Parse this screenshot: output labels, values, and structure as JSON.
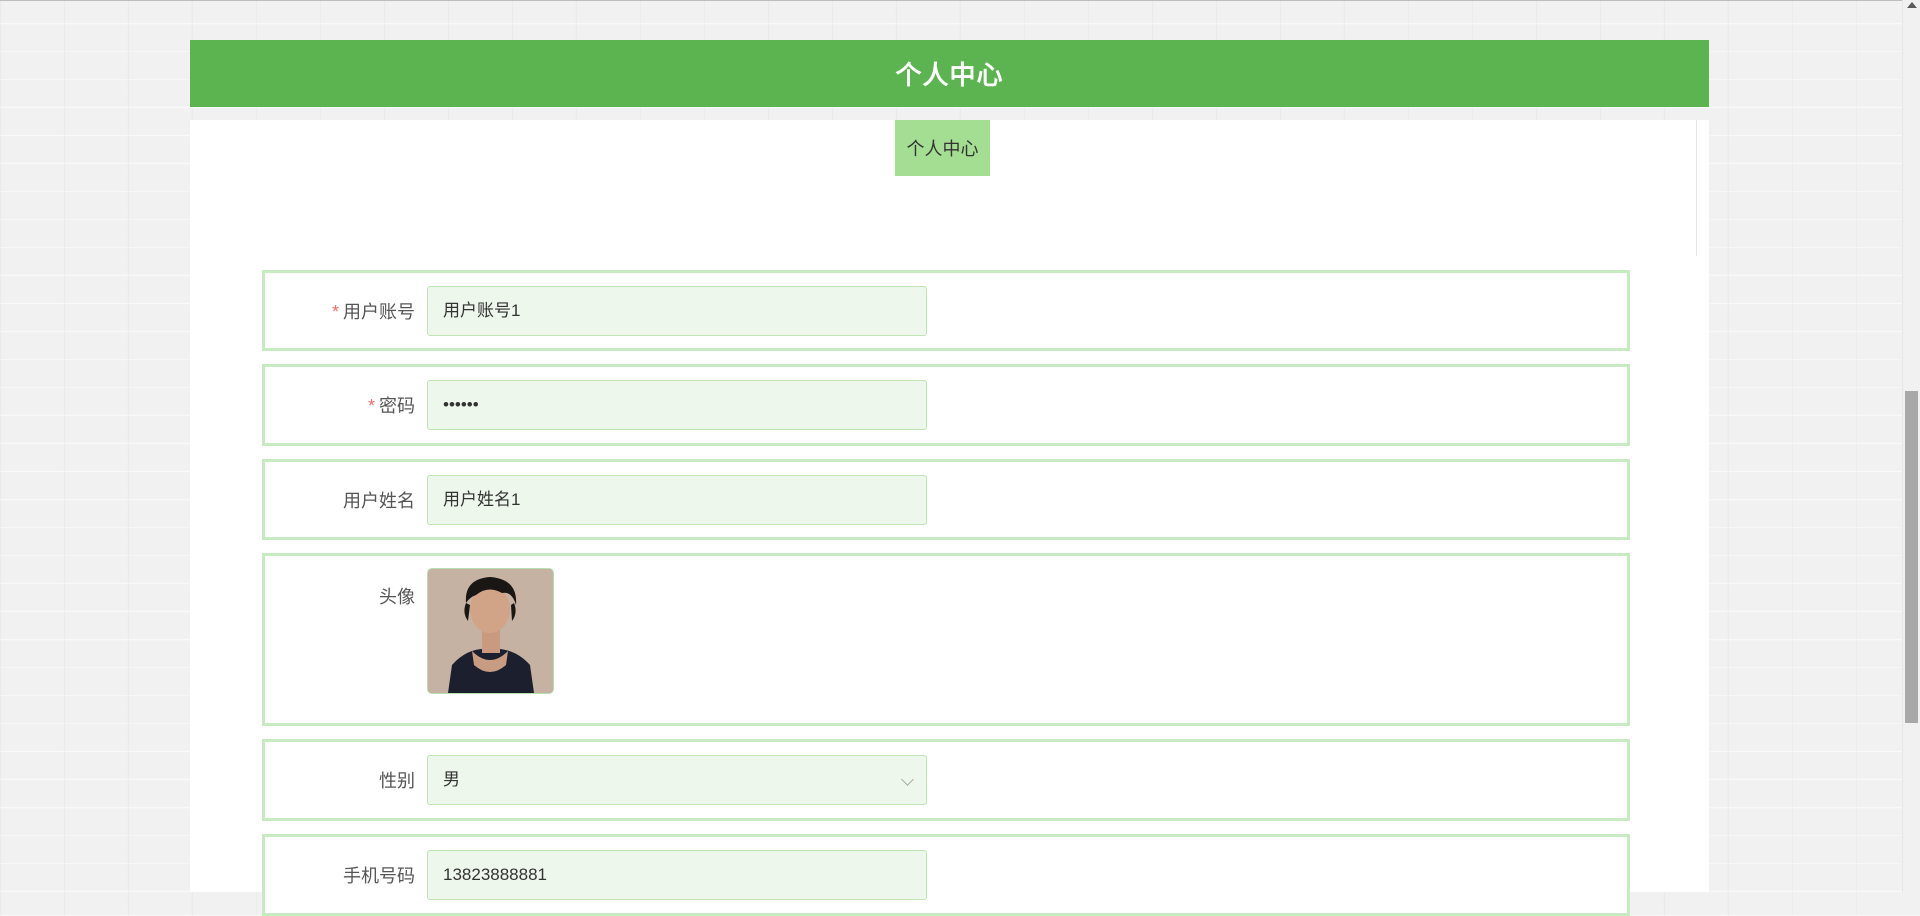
{
  "header": {
    "title": "个人中心"
  },
  "tabs": [
    {
      "label": "个人中心"
    }
  ],
  "form": {
    "username": {
      "label": "用户账号",
      "required": true,
      "value": "用户账号1"
    },
    "password": {
      "label": "密码",
      "required": true,
      "value": "••••••"
    },
    "realname": {
      "label": "用户姓名",
      "value": "用户姓名1"
    },
    "avatar": {
      "label": "头像"
    },
    "gender": {
      "label": "性别",
      "value": "男"
    },
    "phone": {
      "label": "手机号码",
      "value": "13823888881"
    },
    "required_mark": "*"
  },
  "colors": {
    "header_bg": "#5cb450",
    "tab_bg": "#a3de93",
    "row_border": "#c7ebc0",
    "field_bg": "#eef7ec",
    "required": "#f56c6c"
  }
}
